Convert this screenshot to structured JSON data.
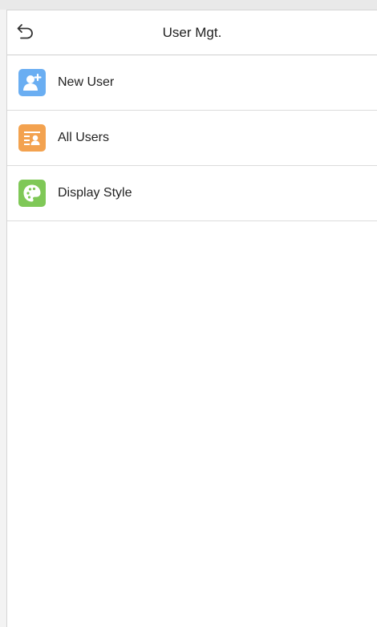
{
  "header": {
    "title": "User Mgt."
  },
  "menu": {
    "items": [
      {
        "label": "New User",
        "icon": "add-user-icon",
        "color": "#6aaef2"
      },
      {
        "label": "All Users",
        "icon": "user-list-icon",
        "color": "#f3a24f"
      },
      {
        "label": "Display Style",
        "icon": "palette-icon",
        "color": "#7fc857"
      }
    ]
  }
}
